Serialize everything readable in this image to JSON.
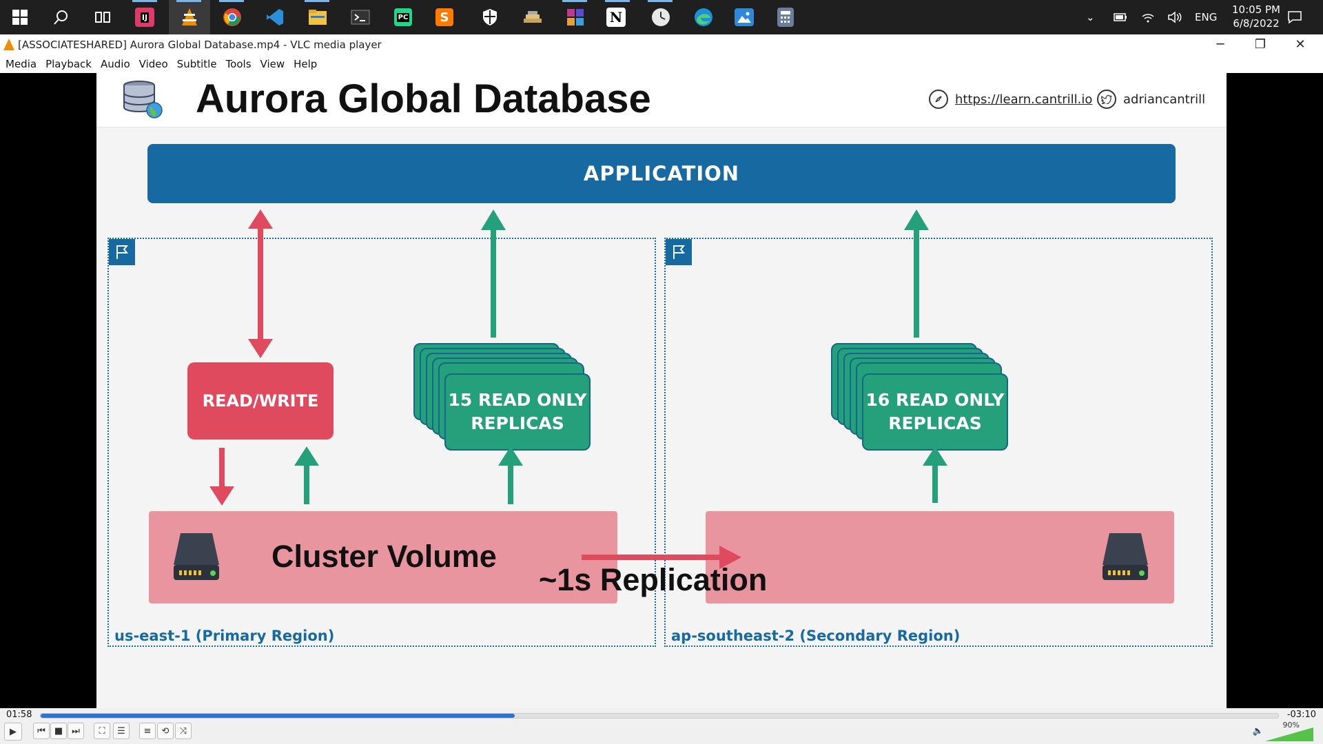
{
  "taskbar": {
    "icons": [
      "windows-start-icon",
      "search-icon",
      "task-view-icon",
      "intellij-icon",
      "vlc-icon",
      "chrome-icon",
      "vscode-icon",
      "file-explorer-icon",
      "terminal-icon",
      "pycharm-icon",
      "sublime-icon",
      "shield-icon",
      "stack-icon",
      "cube-icon",
      "notion-icon",
      "clock-app-icon",
      "edge-icon",
      "photos-icon",
      "calculator-icon"
    ],
    "language": "ENG",
    "time": "10:05 PM",
    "date": "6/8/2022"
  },
  "window": {
    "title": "[ASSOCIATESHARED] Aurora Global Database.mp4 - VLC media player"
  },
  "menu": [
    "Media",
    "Playback",
    "Audio",
    "Video",
    "Subtitle",
    "Tools",
    "View",
    "Help"
  ],
  "slide": {
    "title": "Aurora Global Database",
    "link_url": "https://learn.cantrill.io",
    "twitter": "adriancantrill",
    "application_label": "APPLICATION",
    "read_write_label": "READ/WRITE",
    "primary_replicas": [
      "15 READ ONLY",
      "REPLICAS"
    ],
    "secondary_replicas": [
      "16 READ ONLY",
      "REPLICAS"
    ],
    "cluster_volume_label": "Cluster Volume",
    "replication_label": "~1s Replication",
    "primary_region": "us-east-1 (Primary Region)",
    "secondary_region": "ap-southeast-2 (Secondary Region)",
    "colors": {
      "blue": "#1669a1",
      "red": "#e04a5f",
      "green": "#24a07a",
      "pink": "#e8959f"
    }
  },
  "player": {
    "elapsed": "01:58",
    "remaining": "-03:10",
    "progress": 0.383,
    "volume": "90%"
  }
}
